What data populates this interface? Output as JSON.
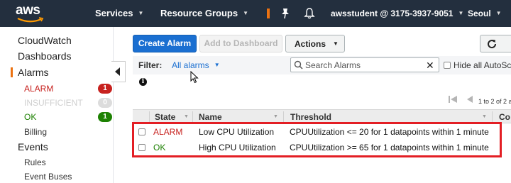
{
  "topbar": {
    "logo": "aws",
    "services": "Services",
    "resource_groups": "Resource Groups",
    "user": "awsstudent @ 3175-3937-9051",
    "region": "Seoul"
  },
  "sidebar": {
    "cloudwatch": "CloudWatch",
    "dashboards": "Dashboards",
    "alarms": "Alarms",
    "alarm_states": [
      {
        "label": "ALARM",
        "count": "1",
        "color": "#c7211e"
      },
      {
        "label": "INSUFFICIENT",
        "count": "0",
        "color": "#cfcfcf"
      },
      {
        "label": "OK",
        "count": "1",
        "color": "#1d8102"
      }
    ],
    "billing": "Billing",
    "events": "Events",
    "rules": "Rules",
    "event_buses": "Event Buses"
  },
  "toolbar": {
    "create_alarm": "Create Alarm",
    "add_to_dashboard": "Add to Dashboard",
    "actions": "Actions"
  },
  "filter": {
    "label": "Filter:",
    "selected": "All alarms",
    "search_placeholder": "Search Alarms",
    "hide_autoscaling": "Hide all AutoScaling"
  },
  "pager": {
    "text": "1 to 2 of 2 a"
  },
  "table": {
    "columns": [
      "State",
      "Name",
      "Threshold",
      "Co"
    ],
    "rows": [
      {
        "state": "ALARM",
        "name": "Low CPU Utilization",
        "threshold": "CPUUtilization <= 20 for 1 datapoints within 1 minute"
      },
      {
        "state": "OK",
        "name": "High CPU Utilization",
        "threshold": "CPUUtilization >= 65 for 1 datapoints within 1 minute"
      }
    ]
  },
  "colors": {
    "nav_bg": "#232f3e",
    "primary": "#1a6fd1",
    "accent": "#ec7211",
    "alarm": "#c7211e",
    "ok": "#1d8102",
    "highlight": "#e31e24"
  }
}
